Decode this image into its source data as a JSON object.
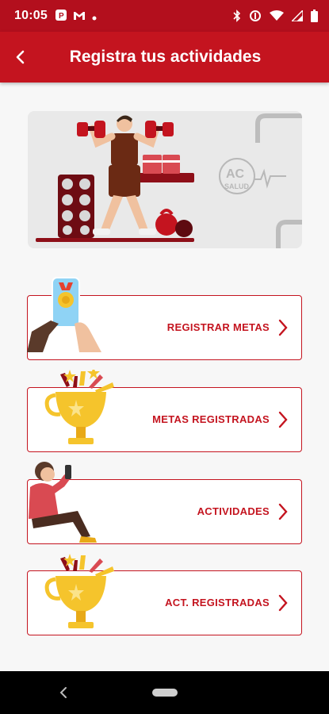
{
  "status_bar": {
    "time": "10:05",
    "left_icons": [
      "app-notification-icon",
      "gmail-icon",
      "dot-icon"
    ],
    "right_icons": [
      "bluetooth-icon",
      "data-saver-icon",
      "wifi-icon",
      "signal-icon",
      "battery-icon"
    ]
  },
  "app_bar": {
    "title": "Registra tus actividades",
    "back_icon": "arrow-back-icon"
  },
  "hero": {
    "illustration": "weightlifter-illustration",
    "logo_text": "AC",
    "logo_subtext": "SALUD"
  },
  "menu": [
    {
      "label": "REGISTRAR METAS",
      "icon": "phone-medal-illustration"
    },
    {
      "label": "METAS REGISTRADAS",
      "icon": "trophy-illustration"
    },
    {
      "label": "ACTIVIDADES",
      "icon": "woman-phone-illustration"
    },
    {
      "label": "ACT. REGISTRADAS",
      "icon": "trophy-illustration"
    }
  ],
  "colors": {
    "primary": "#c4141f",
    "status_bar": "#b30f1d",
    "background": "#f7f7f7",
    "gold": "#f5c42c"
  }
}
